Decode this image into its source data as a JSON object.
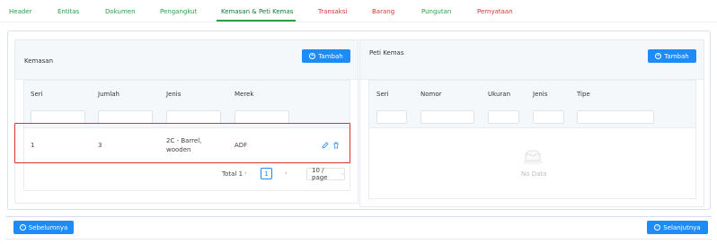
{
  "tabs": [
    {
      "label": "Header"
    },
    {
      "label": "Entitas"
    },
    {
      "label": "Dokumen"
    },
    {
      "label": "Pengangkut"
    },
    {
      "label": "Kemasan & Peti Kemas"
    },
    {
      "label": "Transaksi"
    },
    {
      "label": "Barang"
    },
    {
      "label": "Pungutan"
    },
    {
      "label": "Pernyataan"
    }
  ],
  "kemasan": {
    "title": "Kemasan",
    "add_label": "Tambah",
    "columns": [
      "Seri",
      "Jumlah",
      "Jenis",
      "Merek"
    ],
    "rows": [
      {
        "seri": "1",
        "jumlah": "3",
        "jenis_line1": "2C - Barrel,",
        "jenis_line2": "wooden",
        "merek": "ADF"
      }
    ],
    "pagination": {
      "total": "Total 1",
      "current_page": "1",
      "page_size": "10 / page"
    }
  },
  "peti_kemas": {
    "title": "Peti Kemas",
    "add_label": "Tambah",
    "columns": [
      "Seri",
      "Nomor",
      "Ukuran",
      "Jenis",
      "Tipe"
    ],
    "empty_text": "No Data"
  },
  "footer": {
    "prev_label": "Sebelumnya",
    "next_label": "Selanjutnya"
  },
  "colors": {
    "primary": "#1d8cf8",
    "tab_green": "#2f9e44",
    "tab_red": "#e03131",
    "highlight": "#e03131"
  },
  "icons": [
    "plus-circle-icon",
    "edit-icon",
    "trash-icon",
    "chevron-left-icon",
    "chevron-right-icon",
    "chevron-down-icon",
    "empty-box-icon",
    "arrow-left-circle-icon",
    "arrow-right-circle-icon"
  ]
}
